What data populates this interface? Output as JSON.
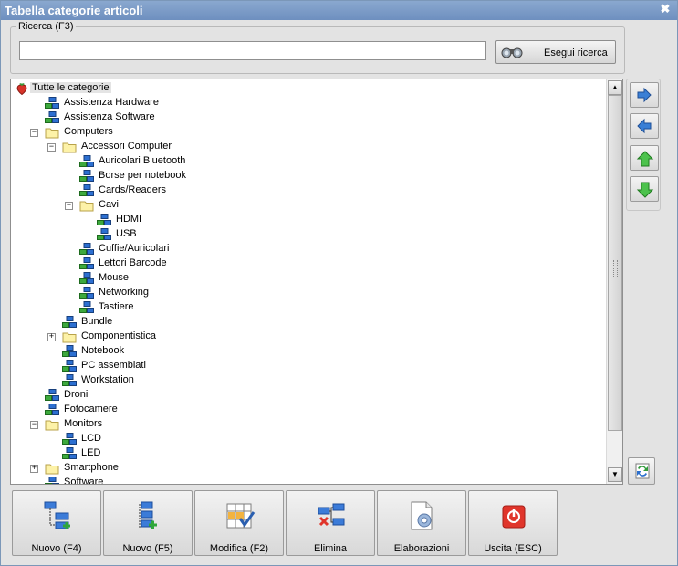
{
  "window": {
    "title": "Tabella categorie articoli",
    "close_glyph": "✖"
  },
  "search": {
    "legend": "Ricerca (F3)",
    "value": "",
    "placeholder": "",
    "button_label": "Esegui ricerca",
    "button_icon": "binoculars-icon"
  },
  "tree": {
    "nodes": [
      {
        "label": "Tutte le categorie",
        "level": 0,
        "icon": "strawberry-icon",
        "toggle": "",
        "selected": true
      },
      {
        "label": "Assistenza Hardware",
        "level": 1,
        "icon": "category-icon",
        "toggle": ""
      },
      {
        "label": "Assistenza Software",
        "level": 1,
        "icon": "category-icon",
        "toggle": ""
      },
      {
        "label": "Computers",
        "level": 1,
        "icon": "folder-icon",
        "toggle": "−"
      },
      {
        "label": "Accessori Computer",
        "level": 2,
        "icon": "folder-icon",
        "toggle": "−"
      },
      {
        "label": "Auricolari Bluetooth",
        "level": 3,
        "icon": "category-icon",
        "toggle": ""
      },
      {
        "label": "Borse per notebook",
        "level": 3,
        "icon": "category-icon",
        "toggle": ""
      },
      {
        "label": "Cards/Readers",
        "level": 3,
        "icon": "category-icon",
        "toggle": ""
      },
      {
        "label": "Cavi",
        "level": 3,
        "icon": "folder-icon",
        "toggle": "−"
      },
      {
        "label": "HDMI",
        "level": 4,
        "icon": "category-icon",
        "toggle": ""
      },
      {
        "label": "USB",
        "level": 4,
        "icon": "category-icon",
        "toggle": ""
      },
      {
        "label": "Cuffie/Auricolari",
        "level": 3,
        "icon": "category-icon",
        "toggle": ""
      },
      {
        "label": "Lettori Barcode",
        "level": 3,
        "icon": "category-icon",
        "toggle": ""
      },
      {
        "label": "Mouse",
        "level": 3,
        "icon": "category-icon",
        "toggle": ""
      },
      {
        "label": "Networking",
        "level": 3,
        "icon": "category-icon",
        "toggle": ""
      },
      {
        "label": "Tastiere",
        "level": 3,
        "icon": "category-icon",
        "toggle": ""
      },
      {
        "label": "Bundle",
        "level": 2,
        "icon": "category-icon",
        "toggle": ""
      },
      {
        "label": "Componentistica",
        "level": 2,
        "icon": "folder-icon",
        "toggle": "+"
      },
      {
        "label": "Notebook",
        "level": 2,
        "icon": "category-icon",
        "toggle": ""
      },
      {
        "label": "PC assemblati",
        "level": 2,
        "icon": "category-icon",
        "toggle": ""
      },
      {
        "label": "Workstation",
        "level": 2,
        "icon": "category-icon",
        "toggle": ""
      },
      {
        "label": "Droni",
        "level": 1,
        "icon": "category-icon",
        "toggle": ""
      },
      {
        "label": "Fotocamere",
        "level": 1,
        "icon": "category-icon",
        "toggle": ""
      },
      {
        "label": "Monitors",
        "level": 1,
        "icon": "folder-icon",
        "toggle": "−"
      },
      {
        "label": "LCD",
        "level": 2,
        "icon": "category-icon",
        "toggle": ""
      },
      {
        "label": "LED",
        "level": 2,
        "icon": "category-icon",
        "toggle": ""
      },
      {
        "label": "Smartphone",
        "level": 1,
        "icon": "folder-icon",
        "toggle": "+"
      },
      {
        "label": "Software",
        "level": 1,
        "icon": "category-icon",
        "toggle": ""
      }
    ]
  },
  "side_buttons": [
    {
      "name": "indent-right-button",
      "icon": "arrow-right-icon",
      "color": "#3a7fd5"
    },
    {
      "name": "indent-left-button",
      "icon": "arrow-left-icon",
      "color": "#3a7fd5"
    },
    {
      "name": "move-up-button",
      "icon": "arrow-up-icon",
      "color": "#3cb53c"
    },
    {
      "name": "move-down-button",
      "icon": "arrow-down-icon",
      "color": "#3cb53c"
    }
  ],
  "refresh_button": {
    "icon": "refresh-icon"
  },
  "toolbar": {
    "buttons": [
      {
        "name": "nuovo-f4-button",
        "label": "Nuovo (F4)",
        "icon": "new-sibling-icon"
      },
      {
        "name": "nuovo-f5-button",
        "label": "Nuovo (F5)",
        "icon": "new-child-icon"
      },
      {
        "name": "modifica-button",
        "label": "Modifica (F2)",
        "icon": "edit-grid-icon"
      },
      {
        "name": "elimina-button",
        "label": "Elimina",
        "icon": "delete-node-icon"
      },
      {
        "name": "elaborazioni-button",
        "label": "Elaborazioni",
        "icon": "process-document-icon"
      },
      {
        "name": "uscita-button",
        "label": "Uscita (ESC)",
        "icon": "power-icon"
      }
    ]
  },
  "colors": {
    "titlebar": "#7b97c6",
    "folder": "#fdf2a8",
    "category_blue": "#2c6fd1",
    "category_green": "#3da93d",
    "power_red": "#e0352b"
  }
}
